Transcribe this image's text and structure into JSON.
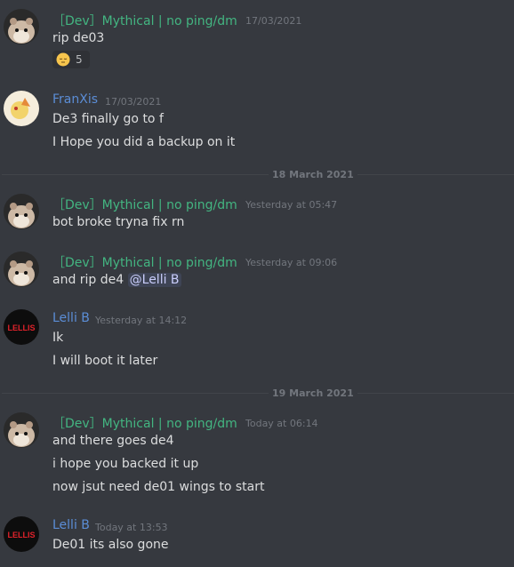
{
  "colors": {
    "mythical_name": "#43b581",
    "lelli_name": "#3ba55c",
    "franxis_name": "#5b8dd6",
    "mention_text": "#c9cdfb"
  },
  "messages": [
    {
      "author": "［Dev］Mythical | no ping/dm",
      "timestamp": "17/03/2021",
      "lines": [
        "rip de03"
      ],
      "reaction": {
        "emoji": "pensive-emoji",
        "count": "5"
      }
    },
    {
      "author": "FranXis",
      "timestamp": "17/03/2021",
      "lines": [
        "De3 finally go to f",
        "I Hope you did a backup on it"
      ]
    },
    {
      "author": "［Dev］Mythical | no ping/dm",
      "timestamp": "Yesterday at 05:47",
      "lines": [
        "bot broke tryna fix rn"
      ]
    },
    {
      "author": "［Dev］Mythical | no ping/dm",
      "timestamp": "Yesterday at 09:06",
      "lines": [
        "and rip de4"
      ],
      "mention": "@Lelli B"
    },
    {
      "author": "Lelli B",
      "timestamp": "Yesterday at 14:12",
      "lines": [
        "Ik",
        "I will boot it later"
      ]
    },
    {
      "author": "［Dev］Mythical | no ping/dm",
      "timestamp": "Today at 06:14",
      "lines": [
        "and there goes de4",
        "i hope you backed it up",
        "now jsut need de01 wings to start"
      ]
    },
    {
      "author": "Lelli B",
      "timestamp": "Today at 13:53",
      "lines": [
        "De01 its also gone"
      ]
    }
  ],
  "dividers": [
    "18 March 2021",
    "19 March 2021"
  ],
  "avatars": {
    "lelli_text": "LELLIS"
  }
}
